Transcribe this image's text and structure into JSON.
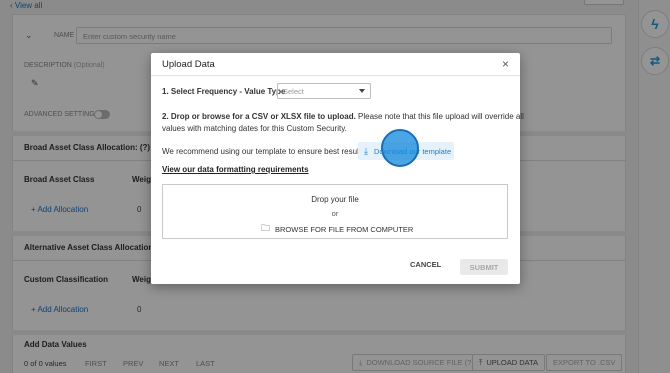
{
  "background": {
    "view_all": "View all",
    "name_label": "NAME",
    "name_placeholder": "Enter custom security name",
    "description_label": "DESCRIPTION",
    "description_optional": "(Optional)",
    "advanced_settings": "ADVANCED SETTINGS",
    "broad_section_title": "Broad Asset Class Allocation: (?)",
    "broad_column": "Broad Asset Class",
    "broad_weight": "Weigh",
    "broad_add": "+ Add Allocation",
    "broad_zero": "0",
    "alt_section_title": "Alternative Asset Class Allocation: (?)",
    "alt_column": "Custom Classification",
    "alt_weight": "Weigh",
    "alt_add": "+ Add Allocation",
    "alt_zero": "0",
    "add_data_title": "Add Data Values",
    "pagination": {
      "count": "0 of 0 values",
      "first": "FIRST",
      "prev": "PREV",
      "next": "NEXT",
      "last": "LAST"
    },
    "footer_buttons": {
      "download_source": "DOWNLOAD SOURCE FILE (?)",
      "upload": "UPLOAD DATA",
      "export": "EXPORT TO .CSV"
    }
  },
  "modal": {
    "title": "Upload Data",
    "close_icon": "×",
    "step1_label": "1. Select Frequency - Value Type",
    "step1_select": "Select",
    "step2_bold": "2. Drop or browse for a CSV or XLSX file to upload.",
    "step2_rest": "Please note that this file upload will override all",
    "step2_line2": "values with matching dates for this Custom Security.",
    "template_hint": "We recommend using our template to ensure best results.",
    "template_button": "Download our template",
    "format_link": "View our data formatting requirements",
    "drop_title": "Drop your file",
    "drop_or": "or",
    "browse": "BROWSE FOR FILE FROM COMPUTER",
    "cancel": "CANCEL",
    "submit": "SUBMIT"
  },
  "colors": {
    "accent": "#1a7fc6",
    "overlay": "rgba(0,0,0,0.42)"
  }
}
